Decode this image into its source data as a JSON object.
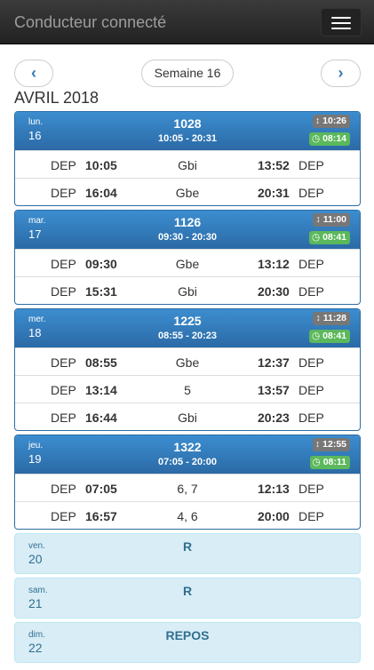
{
  "app": {
    "title": "Conducteur connecté"
  },
  "week_nav": {
    "prev_icon": "chevron-left-icon",
    "label": "Semaine 16",
    "next_icon": "chevron-right-icon",
    "prev_glyph": "‹",
    "next_glyph": "›"
  },
  "month": "AVRIL 2018",
  "days": [
    {
      "dow": "lun.",
      "day": "16",
      "service": "1028",
      "range": "10:05 - 20:31",
      "amplitude": "10:26",
      "pause": "08:14",
      "rows": [
        {
          "dep1": "DEP",
          "start": "10:05",
          "location": "Gbi",
          "end": "13:52",
          "dep2": "DEP"
        },
        {
          "dep1": "DEP",
          "start": "16:04",
          "location": "Gbe",
          "end": "20:31",
          "dep2": "DEP"
        }
      ]
    },
    {
      "dow": "mar.",
      "day": "17",
      "service": "1126",
      "range": "09:30 - 20:30",
      "amplitude": "11:00",
      "pause": "08:41",
      "rows": [
        {
          "dep1": "DEP",
          "start": "09:30",
          "location": "Gbe",
          "end": "13:12",
          "dep2": "DEP"
        },
        {
          "dep1": "DEP",
          "start": "15:31",
          "location": "Gbi",
          "end": "20:30",
          "dep2": "DEP"
        }
      ]
    },
    {
      "dow": "mer.",
      "day": "18",
      "service": "1225",
      "range": "08:55 - 20:23",
      "amplitude": "11:28",
      "pause": "08:41",
      "rows": [
        {
          "dep1": "DEP",
          "start": "08:55",
          "location": "Gbe",
          "end": "12:37",
          "dep2": "DEP"
        },
        {
          "dep1": "DEP",
          "start": "13:14",
          "location": "5",
          "end": "13:57",
          "dep2": "DEP"
        },
        {
          "dep1": "DEP",
          "start": "16:44",
          "location": "Gbi",
          "end": "20:23",
          "dep2": "DEP"
        }
      ]
    },
    {
      "dow": "jeu.",
      "day": "19",
      "service": "1322",
      "range": "07:05 - 20:00",
      "amplitude": "12:55",
      "pause": "08:11",
      "rows": [
        {
          "dep1": "DEP",
          "start": "07:05",
          "location": "6, 7",
          "end": "12:13",
          "dep2": "DEP"
        },
        {
          "dep1": "DEP",
          "start": "16:57",
          "location": "4, 6",
          "end": "20:00",
          "dep2": "DEP"
        }
      ]
    }
  ],
  "rest_days": [
    {
      "dow": "ven.",
      "day": "20",
      "label": "R"
    },
    {
      "dow": "sam.",
      "day": "21",
      "label": "R"
    },
    {
      "dow": "dim.",
      "day": "22",
      "label": "REPOS"
    }
  ],
  "colors": {
    "navbar": "#222222",
    "panel_header": "#337ab7",
    "badge_amplitude": "#777777",
    "badge_pause": "#5cb85c",
    "rest_bg": "#d9edf7",
    "rest_text": "#31708f"
  }
}
